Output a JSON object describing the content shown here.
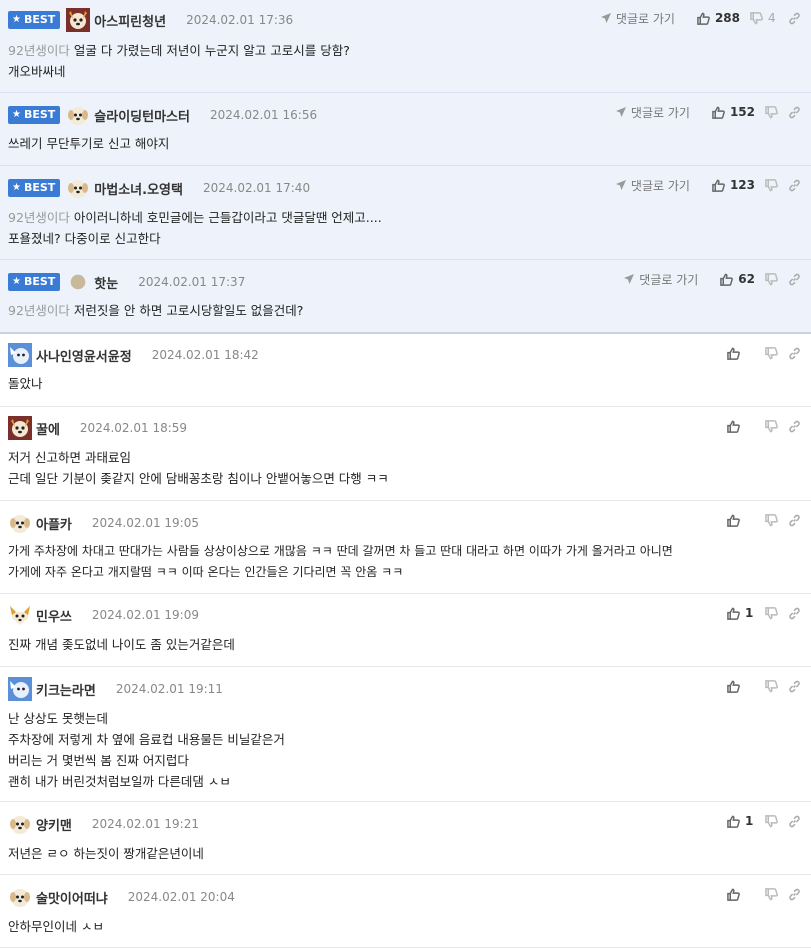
{
  "best_label": "BEST",
  "goto_label": "댓글로 가기",
  "best_comments": [
    {
      "nick": "아스피린청년",
      "avatar": "dog-red",
      "date": "2024.02.01 17:36",
      "mention": "92년생이다",
      "lines": [
        "얼굴 다 가렸는데 저년이 누군지 알고 고로시를 당함?",
        "개오바싸네"
      ],
      "likes": "288",
      "dislikes": "4"
    },
    {
      "nick": "슬라이딩턴마스터",
      "avatar": "puppy",
      "date": "2024.02.01 16:56",
      "mention": "",
      "lines": [
        "쓰레기 무단투기로 신고 해야지"
      ],
      "likes": "152",
      "dislikes": ""
    },
    {
      "nick": "마법소녀.오영택",
      "avatar": "puppy",
      "date": "2024.02.01 17:40",
      "mention": "92년생이다",
      "lines": [
        "아이러니하네 호민글에는 근들갑이라고 댓글달땐 언제고....",
        "포욜졌네? 다중이로 신고한다"
      ],
      "likes": "123",
      "dislikes": ""
    },
    {
      "nick": "핫눈",
      "avatar": "dot",
      "date": "2024.02.01 17:37",
      "mention": "92년생이다",
      "lines": [
        "저런짓을 안 하면 고로시당할일도 없을건데?"
      ],
      "likes": "62",
      "dislikes": ""
    }
  ],
  "comments": [
    {
      "nick": "사나인영윤서윤정",
      "avatar": "blue",
      "date": "2024.02.01 18:42",
      "lines": [
        "돌았나"
      ],
      "likes": ""
    },
    {
      "nick": "꿀에",
      "avatar": "dog-red",
      "date": "2024.02.01 18:59",
      "lines": [
        "저거 신고하면 과태료임",
        "근데 일단 기분이 좆같지 안에 담배꽁초랑 침이나 안뱉어놓으면 다행 ㅋㅋ"
      ],
      "likes": ""
    },
    {
      "nick": "아플카",
      "avatar": "puppy",
      "date": "2024.02.01 19:05",
      "lines": [
        "가게 주차장에 차대고 딴대가는 사람들 상상이상으로 개많음 ㅋㅋ 딴데 갈꺼면 차 들고 딴대 대라고 하면 이따가 가게 올거라고 아니면",
        "가게에 자주 온다고 개지랄떰 ㅋㅋ 이따 온다는 인간들은 기다리면 꼭 안옴 ㅋㅋ"
      ],
      "likes": ""
    },
    {
      "nick": "민우쓰",
      "avatar": "fox",
      "date": "2024.02.01 19:09",
      "lines": [
        "진짜 개념 좆도없네 나이도 좀 있는거같은데"
      ],
      "likes": "1"
    },
    {
      "nick": "키크는라면",
      "avatar": "blue",
      "date": "2024.02.01 19:11",
      "lines": [
        "난 상상도 못햇는데",
        "주차장에 저렇게 차 옆에 음료컵 내용물든 비닐같은거",
        "버리는 거 몇번씩 봄 진짜 어지럽다",
        "괜히 내가 버린것처럼보일까 다른데댐 ㅅㅂ"
      ],
      "likes": ""
    },
    {
      "nick": "양키맨",
      "avatar": "puppy",
      "date": "2024.02.01 19:21",
      "lines": [
        "저년은 ㄹㅇ 하는짓이 짱개같은년이네"
      ],
      "likes": "1"
    },
    {
      "nick": "술맛이어떠냐",
      "avatar": "puppy",
      "date": "2024.02.01 20:04",
      "lines": [
        "안하무인이네 ㅅㅂ"
      ],
      "likes": ""
    }
  ],
  "colors": {
    "best_bg": "#eef3fb",
    "badge": "#3a7bd5"
  }
}
